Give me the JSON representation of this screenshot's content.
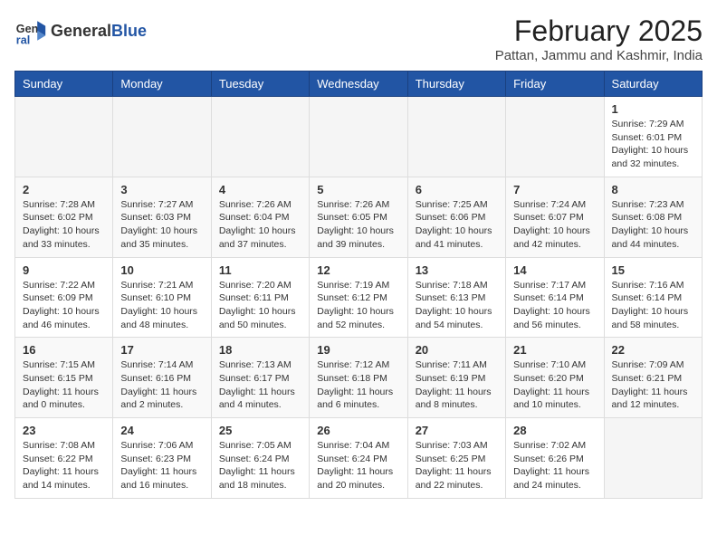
{
  "header": {
    "logo_general": "General",
    "logo_blue": "Blue",
    "title": "February 2025",
    "subtitle": "Pattan, Jammu and Kashmir, India"
  },
  "weekdays": [
    "Sunday",
    "Monday",
    "Tuesday",
    "Wednesday",
    "Thursday",
    "Friday",
    "Saturday"
  ],
  "weeks": [
    [
      {
        "day": "",
        "info": ""
      },
      {
        "day": "",
        "info": ""
      },
      {
        "day": "",
        "info": ""
      },
      {
        "day": "",
        "info": ""
      },
      {
        "day": "",
        "info": ""
      },
      {
        "day": "",
        "info": ""
      },
      {
        "day": "1",
        "info": "Sunrise: 7:29 AM\nSunset: 6:01 PM\nDaylight: 10 hours and 32 minutes."
      }
    ],
    [
      {
        "day": "2",
        "info": "Sunrise: 7:28 AM\nSunset: 6:02 PM\nDaylight: 10 hours and 33 minutes."
      },
      {
        "day": "3",
        "info": "Sunrise: 7:27 AM\nSunset: 6:03 PM\nDaylight: 10 hours and 35 minutes."
      },
      {
        "day": "4",
        "info": "Sunrise: 7:26 AM\nSunset: 6:04 PM\nDaylight: 10 hours and 37 minutes."
      },
      {
        "day": "5",
        "info": "Sunrise: 7:26 AM\nSunset: 6:05 PM\nDaylight: 10 hours and 39 minutes."
      },
      {
        "day": "6",
        "info": "Sunrise: 7:25 AM\nSunset: 6:06 PM\nDaylight: 10 hours and 41 minutes."
      },
      {
        "day": "7",
        "info": "Sunrise: 7:24 AM\nSunset: 6:07 PM\nDaylight: 10 hours and 42 minutes."
      },
      {
        "day": "8",
        "info": "Sunrise: 7:23 AM\nSunset: 6:08 PM\nDaylight: 10 hours and 44 minutes."
      }
    ],
    [
      {
        "day": "9",
        "info": "Sunrise: 7:22 AM\nSunset: 6:09 PM\nDaylight: 10 hours and 46 minutes."
      },
      {
        "day": "10",
        "info": "Sunrise: 7:21 AM\nSunset: 6:10 PM\nDaylight: 10 hours and 48 minutes."
      },
      {
        "day": "11",
        "info": "Sunrise: 7:20 AM\nSunset: 6:11 PM\nDaylight: 10 hours and 50 minutes."
      },
      {
        "day": "12",
        "info": "Sunrise: 7:19 AM\nSunset: 6:12 PM\nDaylight: 10 hours and 52 minutes."
      },
      {
        "day": "13",
        "info": "Sunrise: 7:18 AM\nSunset: 6:13 PM\nDaylight: 10 hours and 54 minutes."
      },
      {
        "day": "14",
        "info": "Sunrise: 7:17 AM\nSunset: 6:14 PM\nDaylight: 10 hours and 56 minutes."
      },
      {
        "day": "15",
        "info": "Sunrise: 7:16 AM\nSunset: 6:14 PM\nDaylight: 10 hours and 58 minutes."
      }
    ],
    [
      {
        "day": "16",
        "info": "Sunrise: 7:15 AM\nSunset: 6:15 PM\nDaylight: 11 hours and 0 minutes."
      },
      {
        "day": "17",
        "info": "Sunrise: 7:14 AM\nSunset: 6:16 PM\nDaylight: 11 hours and 2 minutes."
      },
      {
        "day": "18",
        "info": "Sunrise: 7:13 AM\nSunset: 6:17 PM\nDaylight: 11 hours and 4 minutes."
      },
      {
        "day": "19",
        "info": "Sunrise: 7:12 AM\nSunset: 6:18 PM\nDaylight: 11 hours and 6 minutes."
      },
      {
        "day": "20",
        "info": "Sunrise: 7:11 AM\nSunset: 6:19 PM\nDaylight: 11 hours and 8 minutes."
      },
      {
        "day": "21",
        "info": "Sunrise: 7:10 AM\nSunset: 6:20 PM\nDaylight: 11 hours and 10 minutes."
      },
      {
        "day": "22",
        "info": "Sunrise: 7:09 AM\nSunset: 6:21 PM\nDaylight: 11 hours and 12 minutes."
      }
    ],
    [
      {
        "day": "23",
        "info": "Sunrise: 7:08 AM\nSunset: 6:22 PM\nDaylight: 11 hours and 14 minutes."
      },
      {
        "day": "24",
        "info": "Sunrise: 7:06 AM\nSunset: 6:23 PM\nDaylight: 11 hours and 16 minutes."
      },
      {
        "day": "25",
        "info": "Sunrise: 7:05 AM\nSunset: 6:24 PM\nDaylight: 11 hours and 18 minutes."
      },
      {
        "day": "26",
        "info": "Sunrise: 7:04 AM\nSunset: 6:24 PM\nDaylight: 11 hours and 20 minutes."
      },
      {
        "day": "27",
        "info": "Sunrise: 7:03 AM\nSunset: 6:25 PM\nDaylight: 11 hours and 22 minutes."
      },
      {
        "day": "28",
        "info": "Sunrise: 7:02 AM\nSunset: 6:26 PM\nDaylight: 11 hours and 24 minutes."
      },
      {
        "day": "",
        "info": ""
      }
    ]
  ]
}
